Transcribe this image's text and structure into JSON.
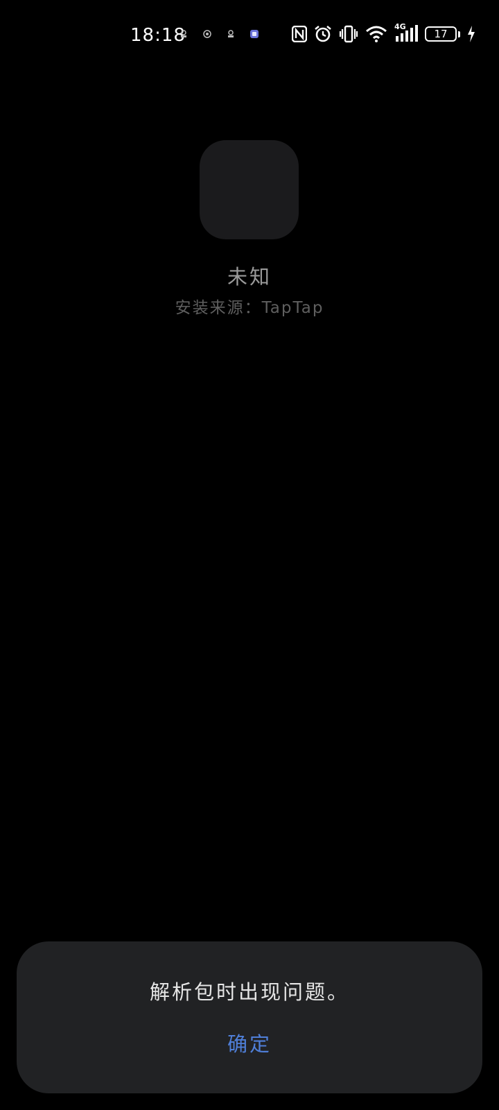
{
  "status_bar": {
    "time": "18:18",
    "battery_level": "17",
    "network_label": "4G",
    "notification_icons": [
      "app-notification-icon",
      "app-notification-icon",
      "app-notification-icon",
      "app-notification-icon"
    ],
    "system_icons": [
      "nfc-icon",
      "alarm-icon",
      "vibrate-icon",
      "wifi-icon",
      "signal-icon",
      "battery-icon",
      "charging-icon"
    ]
  },
  "app": {
    "name": "未知",
    "install_source": "安装来源：TapTap"
  },
  "dialog": {
    "message": "解析包时出现问题。",
    "confirm_label": "确定"
  },
  "colors": {
    "background": "#000000",
    "dialog_background": "#212224",
    "accent": "#4f7fd8",
    "app_icon_placeholder": "#1b1b1d"
  }
}
